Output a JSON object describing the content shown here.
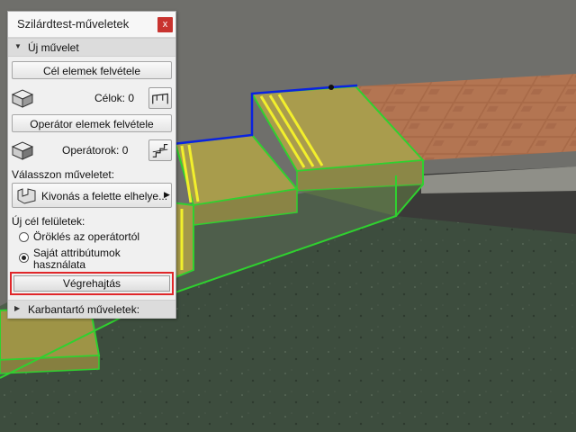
{
  "window": {
    "title": "Szilárdtest-műveletek",
    "close_glyph": "x"
  },
  "new_operation": {
    "section_label": "Új művelet",
    "target_button": "Cél elemek felvétele",
    "targets_label": "Célok: 0",
    "operator_button": "Operátor elemek felvétele",
    "operators_label": "Operátorok: 0",
    "choose_label": "Válasszon műveletet:",
    "operation_value": "Kivonás a felette elhelye...",
    "new_surfaces_label": "Új cél felületek:",
    "radio_inherit": "Öröklés az operátortól",
    "radio_own_line1": "Saját attribútumok",
    "radio_own_line2": "használata",
    "execute_button": "Végrehajtás"
  },
  "maintenance": {
    "section_label": "Karbantartó műveletek:"
  },
  "icons": {
    "targets_icon": "box-target-icon",
    "targets_tool": "stair-pick-icon",
    "operators_icon": "box-operator-icon",
    "operators_tool": "stair-pick-icon",
    "operation_icon": "subtract-operation-icon"
  },
  "colors": {
    "highlight_border": "#e0272a",
    "selection_green": "#2fd12f",
    "selection_blue": "#0b23e0",
    "close_button": "#c8332f"
  }
}
